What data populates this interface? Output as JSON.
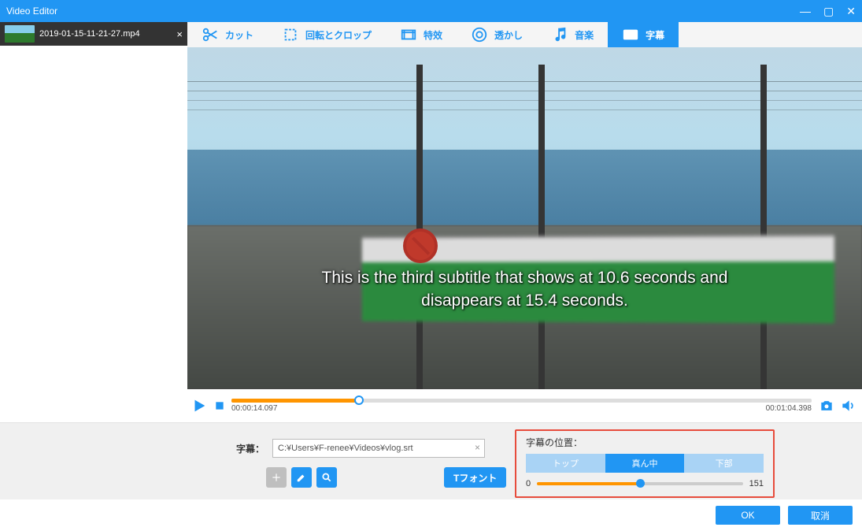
{
  "window": {
    "title": "Video Editor"
  },
  "sidebar": {
    "file_name": "2019-01-15-11-21-27.mp4"
  },
  "toolbar": {
    "tabs": [
      {
        "label": "カット"
      },
      {
        "label": "回転とクロップ"
      },
      {
        "label": "特效"
      },
      {
        "label": "透かし"
      },
      {
        "label": "音楽"
      },
      {
        "label": "字幕"
      }
    ]
  },
  "preview": {
    "subtitle_line1": "This is the third subtitle that shows at 10.6 seconds and",
    "subtitle_line2": "disappears at 15.4 seconds."
  },
  "playbar": {
    "current_time": "00:00:14.097",
    "total_time": "00:01:04.398"
  },
  "subtitle_panel": {
    "label": "字幕：",
    "path": "C:¥Users¥F-renee¥Videos¥vlog.srt",
    "font_button": "Tフォント",
    "position_title": "字幕の位置：",
    "segments": {
      "top": "トップ",
      "middle": "真ん中",
      "bottom": "下部"
    },
    "range_min": "0",
    "range_val": "151"
  },
  "footer": {
    "ok": "OK",
    "cancel": "取消"
  }
}
